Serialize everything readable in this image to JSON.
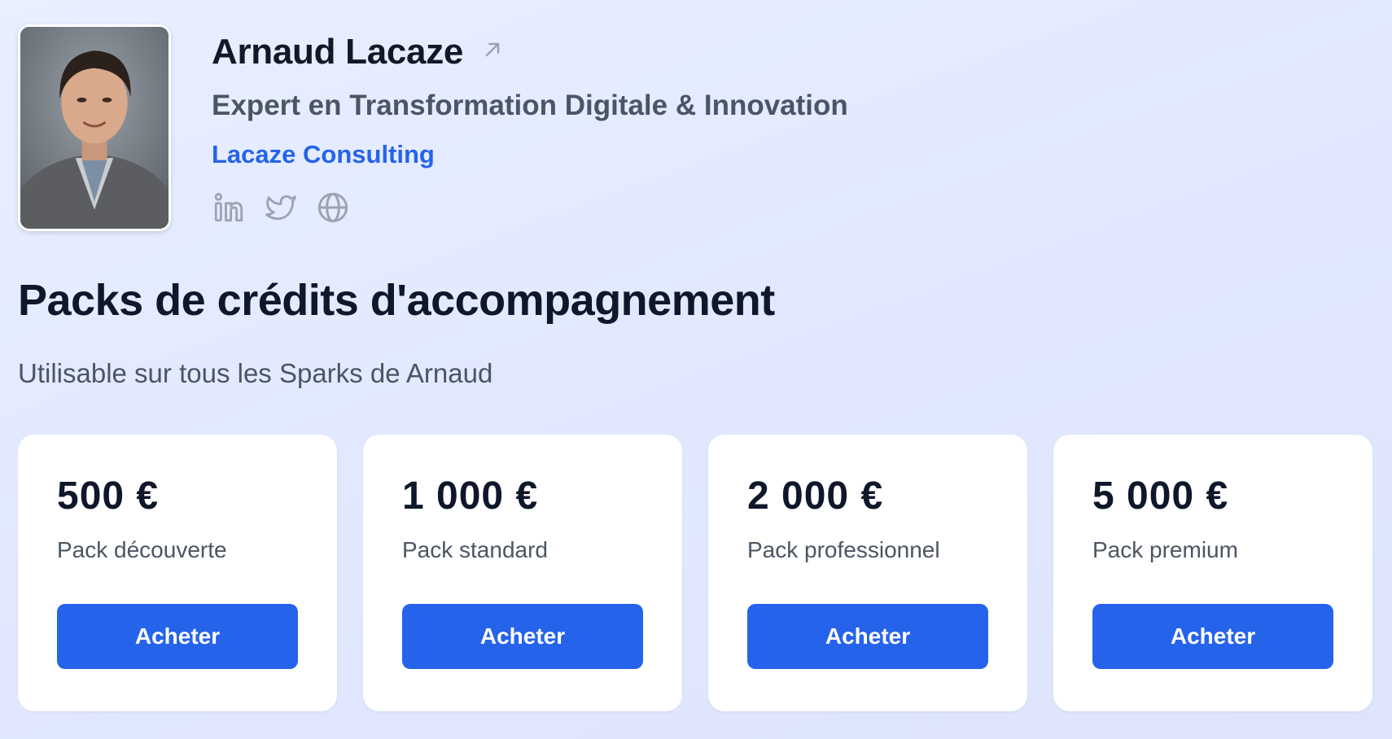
{
  "profile": {
    "name": "Arnaud Lacaze",
    "title": "Expert en Transformation Digitale & Innovation",
    "company": "Lacaze Consulting",
    "name_link_icon": "external-link-arrow-icon",
    "socials": [
      {
        "icon": "linkedin-icon"
      },
      {
        "icon": "twitter-icon"
      },
      {
        "icon": "globe-icon"
      }
    ],
    "icon_color": "#9ca3af"
  },
  "section": {
    "heading": "Packs de crédits d'accompagnement",
    "subtitle": "Utilisable sur tous les Sparks de Arnaud"
  },
  "packs": [
    {
      "price": "500 €",
      "name": "Pack découverte",
      "button": "Acheter"
    },
    {
      "price": "1 000 €",
      "name": "Pack standard",
      "button": "Acheter"
    },
    {
      "price": "2 000 €",
      "name": "Pack professionnel",
      "button": "Acheter"
    },
    {
      "price": "5 000 €",
      "name": "Pack premium",
      "button": "Acheter"
    }
  ],
  "colors": {
    "accent": "#2563eb",
    "heading": "#0f172a",
    "muted": "#4b5563"
  }
}
